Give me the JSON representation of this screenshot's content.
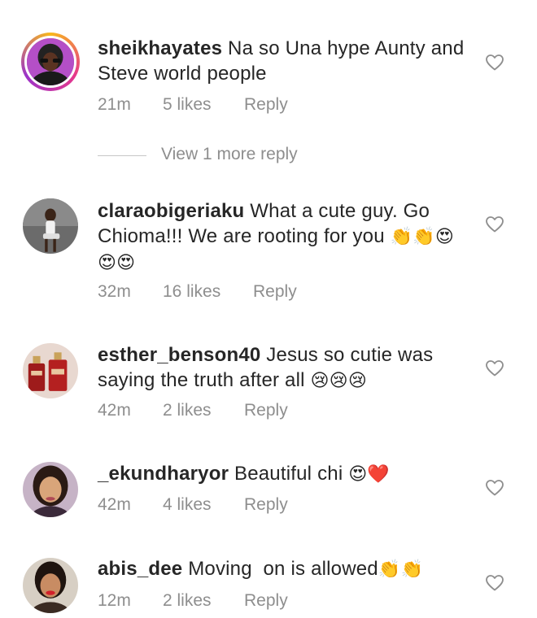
{
  "comments": [
    {
      "username": "sheikhayates",
      "text": "Na so Una hype Aunty and Steve world people",
      "emoji": "",
      "time": "21m",
      "likes": "5 likes",
      "reply": "Reply",
      "avatar": "avatar-woman-purple"
    },
    {
      "username": "claraobigeriaku",
      "text": "What a cute guy. Go Chioma!!! We are rooting for you",
      "emoji": "👏👏😍😍😍",
      "time": "32m",
      "likes": "16 likes",
      "reply": "Reply",
      "avatar": "avatar-woman-sitting"
    },
    {
      "username": "esther_benson40",
      "text": "Jesus so cutie was saying the truth after all",
      "emoji": "😢😢😢",
      "time": "42m",
      "likes": "2 likes",
      "reply": "Reply",
      "avatar": "avatar-perfume-bottles"
    },
    {
      "username": "_ekundharyor",
      "text": "Beautiful chi",
      "emoji": "😍❤️",
      "time": "42m",
      "likes": "4 likes",
      "reply": "Reply",
      "avatar": "avatar-woman-selfie"
    },
    {
      "username": "abis_dee",
      "text": "Moving  on is allowed",
      "emoji": "👏👏",
      "time": "12m",
      "likes": "2 likes",
      "reply": "Reply",
      "avatar": "avatar-woman-red-lips"
    }
  ],
  "view_more_replies": "View 1 more reply",
  "colors": {
    "text": "#262626",
    "meta": "#8e8e8e",
    "ring": "#e6378c"
  }
}
